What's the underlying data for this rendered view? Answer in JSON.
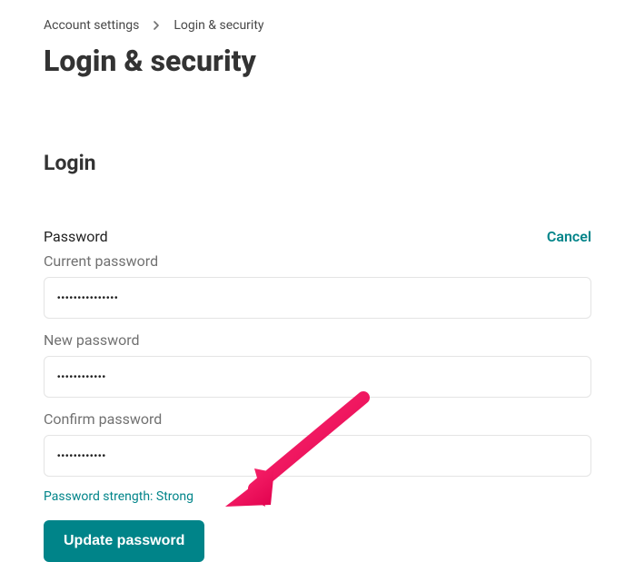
{
  "breadcrumb": {
    "root": "Account settings",
    "current": "Login & security"
  },
  "page": {
    "title": "Login & security"
  },
  "section": {
    "title": "Login"
  },
  "password": {
    "header_label": "Password",
    "cancel_label": "Cancel",
    "current_label": "Current password",
    "current_value": "•••••••••••••••",
    "new_label": "New password",
    "new_value": "••••••••••••",
    "confirm_label": "Confirm password",
    "confirm_value": "••••••••••••",
    "strength_text": "Password strength: Strong",
    "update_button": "Update password"
  },
  "colors": {
    "accent": "#008489",
    "arrow": "#ec1d61"
  }
}
